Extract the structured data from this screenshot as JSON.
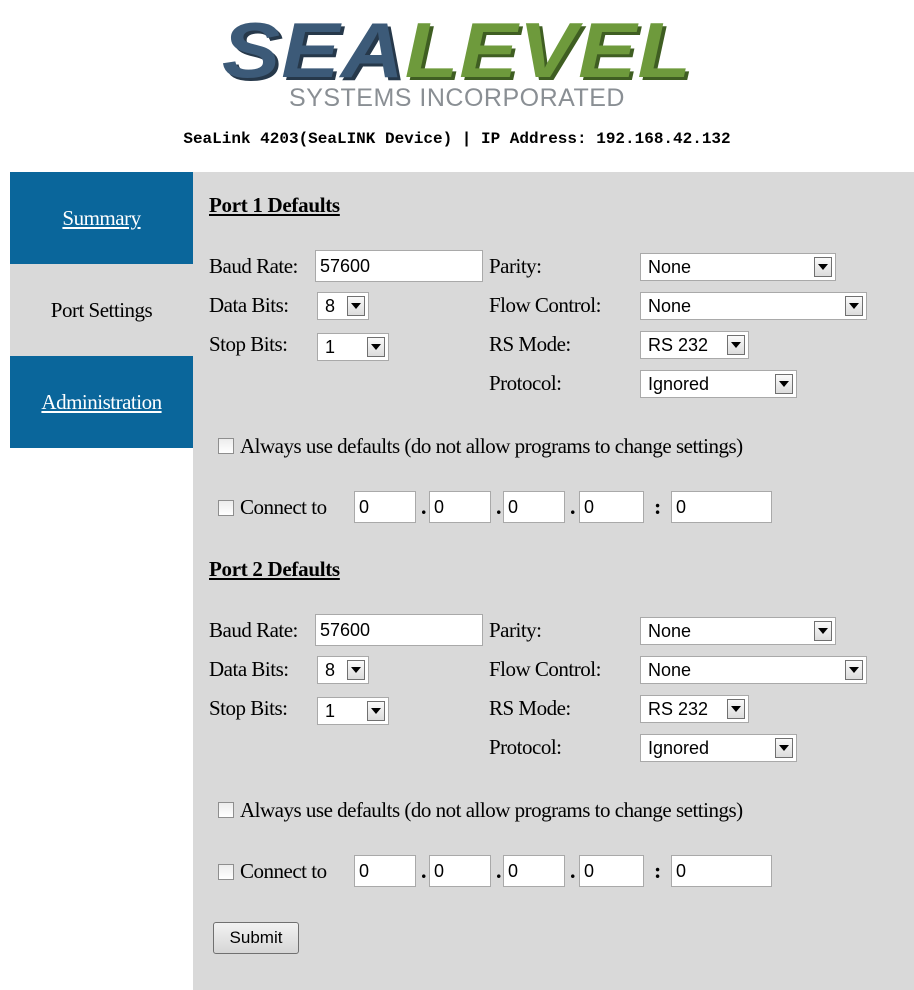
{
  "header": {
    "logo_part1": "SEA",
    "logo_part2": "LEVEL",
    "logo_sub": "SYSTEMS INCORPORATED",
    "device_line": "SeaLink 4203(SeaLINK Device) | IP Address: 192.168.42.132"
  },
  "colors": {
    "nav_blue": "#0a669b",
    "panel_gray": "#d9d9d9",
    "logo_blue": "#3c5a78",
    "logo_green": "#6e9a3c"
  },
  "nav": {
    "summary": "Summary",
    "port_settings": "Port Settings",
    "administration": "Administration"
  },
  "labels": {
    "baud_rate": "Baud Rate:",
    "data_bits": "Data Bits:",
    "stop_bits": "Stop Bits:",
    "parity": "Parity:",
    "flow_control": "Flow Control:",
    "rs_mode": "RS Mode:",
    "protocol": "Protocol:",
    "always_defaults": "Always use defaults (do not allow programs to change settings)",
    "connect_to": "Connect to",
    "dot": ".",
    "colon": ":"
  },
  "ports": [
    {
      "title": "Port 1 Defaults",
      "baud_rate": "57600",
      "data_bits": "8",
      "stop_bits": "1",
      "parity": "None",
      "flow_control": "None",
      "rs_mode": "RS 232",
      "protocol": "Ignored",
      "ip": [
        "0",
        "0",
        "0",
        "0"
      ],
      "port": "0"
    },
    {
      "title": "Port 2 Defaults",
      "baud_rate": "57600",
      "data_bits": "8",
      "stop_bits": "1",
      "parity": "None",
      "flow_control": "None",
      "rs_mode": "RS 232",
      "protocol": "Ignored",
      "ip": [
        "0",
        "0",
        "0",
        "0"
      ],
      "port": "0"
    }
  ],
  "submit_label": "Submit"
}
